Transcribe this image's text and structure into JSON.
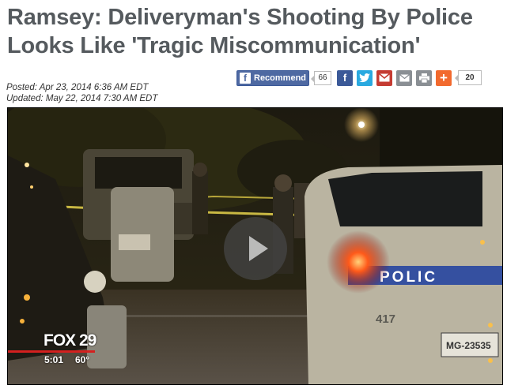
{
  "article": {
    "headline": "Ramsey: Deliveryman's Shooting By Police Looks Like 'Tragic Miscommunication'",
    "posted": "Posted: Apr 23, 2014 6:36 AM EDT",
    "updated": "Updated: May 22, 2014 7:30 AM EDT"
  },
  "share": {
    "recommend_label": "Recommend",
    "recommend_count": "66",
    "share_count": "20",
    "icons": [
      "facebook-icon",
      "twitter-icon",
      "gmail-icon",
      "email-icon",
      "print-icon",
      "plus-icon"
    ]
  },
  "video": {
    "station_logo": "FOX 29",
    "time": "5:01",
    "temperature": "60°",
    "police_car_text": "POLIC",
    "car_number": "417",
    "plate": "MG-23535"
  },
  "colors": {
    "headline": "#555a5e",
    "facebook": "#3b5998",
    "twitter": "#2aa9e0",
    "gmail": "#c53b32",
    "plus": "#f26a2e",
    "fox_red": "#d4201f"
  }
}
